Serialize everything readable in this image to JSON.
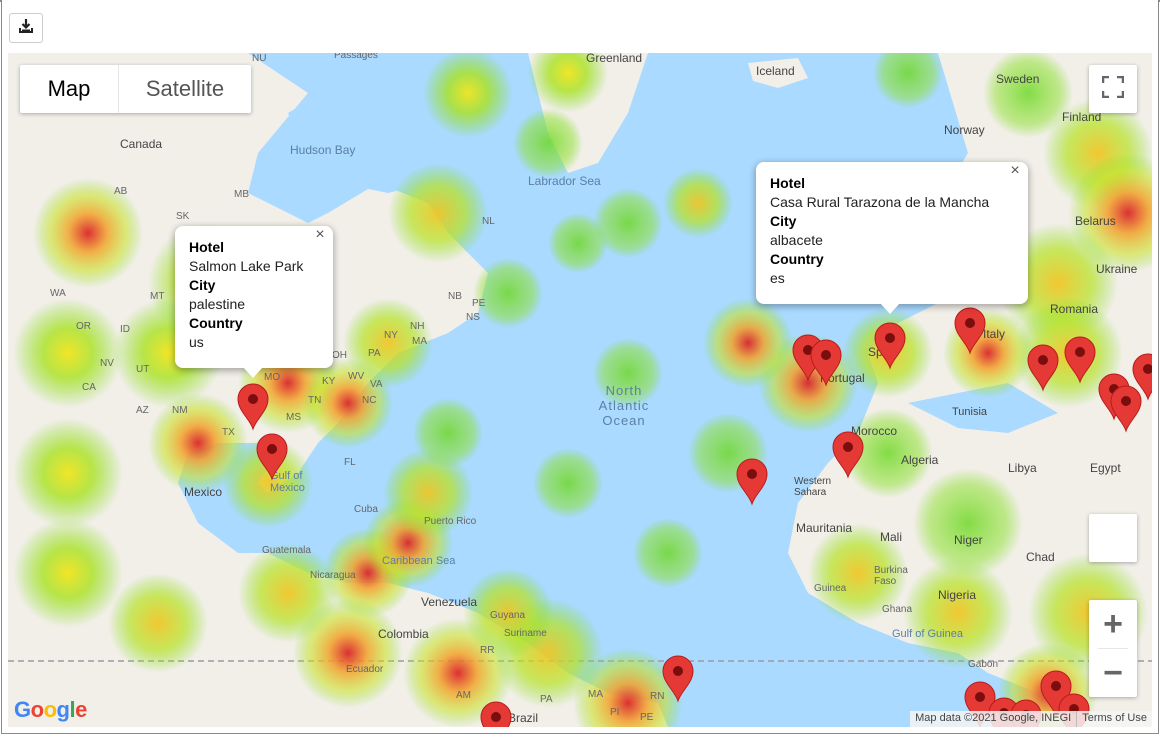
{
  "toolbar": {
    "download_icon": "download-icon"
  },
  "map_type": {
    "map_label": "Map",
    "satellite_label": "Satellite",
    "selected": "Map"
  },
  "controls": {
    "fullscreen_icon": "fullscreen-icon",
    "pegman_icon": "pegman-icon",
    "zoom_in": "+",
    "zoom_out": "−"
  },
  "info_windows": [
    {
      "hotel_label": "Hotel",
      "hotel": "Salmon Lake Park",
      "city_label": "City",
      "city": "palestine",
      "country_label": "Country",
      "country": "us",
      "close": "×"
    },
    {
      "hotel_label": "Hotel",
      "hotel": "Casa Rural Tarazona de la Mancha",
      "city_label": "City",
      "city": "albacete",
      "country_label": "Country",
      "country": "es",
      "close": "×"
    }
  ],
  "map_labels": {
    "greenland": "Greenland",
    "iceland": "Iceland",
    "sweden": "Sweden",
    "finland": "Finland",
    "norway": "Norway",
    "canada": "Canada",
    "hudson_bay": "Hudson Bay",
    "labrador_sea": "Labrador Sea",
    "belarus": "Belarus",
    "ukraine": "Ukraine",
    "romania": "Romania",
    "italy": "Italy",
    "spain": "Spain",
    "portugal": "Portugal",
    "tunisia": "Tunisia",
    "morocco": "Morocco",
    "algeria": "Algeria",
    "libya": "Libya",
    "egypt": "Egypt",
    "western_sahara": "Western Sahara",
    "mauritania": "Mauritania",
    "mali": "Mali",
    "niger": "Niger",
    "chad": "Chad",
    "burkina_faso": "Burkina Faso",
    "guinea": "Guinea",
    "ghana": "Ghana",
    "nigeria": "Nigeria",
    "gulf_of_guinea": "Gulf of Guinea",
    "gabon": "Gabon",
    "north_atlantic_ocean": "North Atlantic Ocean",
    "mexico": "Mexico",
    "gulf_of_mexico": "Gulf of Mexico",
    "cuba": "Cuba",
    "puerto_rico": "Puerto Rico",
    "guatemala": "Guatemala",
    "nicaragua": "Nicaragua",
    "caribbean_sea": "Caribbean Sea",
    "venezuela": "Venezuela",
    "guyana": "Guyana",
    "suriname": "Suriname",
    "colombia": "Colombia",
    "ecuador": "Ecuador",
    "brazil": "Brazil",
    "nu": "NU",
    "ab": "AB",
    "mb": "MB",
    "sk": "SK",
    "nl": "NL",
    "wa": "WA",
    "mt": "MT",
    "or": "OR",
    "id": "ID",
    "nv": "NV",
    "ut": "UT",
    "ca": "CA",
    "az": "AZ",
    "nm": "NM",
    "tx": "TX",
    "mo": "MO",
    "oh": "OH",
    "pa": "PA",
    "ny": "NY",
    "ky": "KY",
    "wv": "WV",
    "va": "VA",
    "nc": "NC",
    "tn": "TN",
    "ms": "MS",
    "fl": "FL",
    "nb": "NB",
    "pe": "PE",
    "ns": "NS",
    "nh": "NH",
    "ma": "MA",
    "rr": "RR",
    "am": "AM",
    "pa_br": "PA",
    "ma_br": "MA",
    "rn": "RN",
    "pi": "PI",
    "pe_br": "PE",
    "passages": "Passages"
  },
  "attribution": {
    "google": "Google",
    "map_data": "Map data ©2021 Google, INEGI",
    "terms": "Terms of Use"
  },
  "colors": {
    "water": "#aadaff",
    "land": "#f2efe9",
    "heat_green": "#7ddc1f",
    "heat_yellow": "#f2e51d",
    "heat_orange": "#f2a12a",
    "heat_red": "#d9262a",
    "marker": "#e53935"
  },
  "markers_count": 29
}
